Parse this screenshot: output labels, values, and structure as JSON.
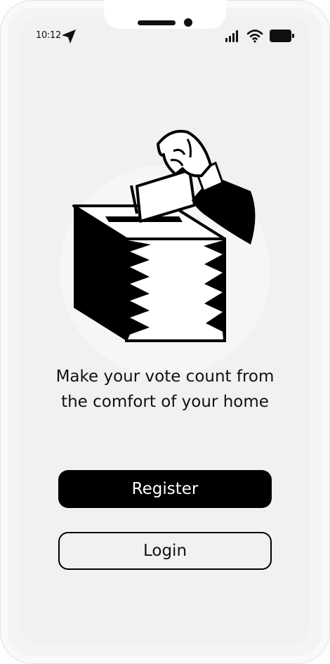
{
  "status_bar": {
    "time": "10:12",
    "icons": [
      "location-arrow-icon",
      "signal-icon",
      "wifi-icon",
      "battery-icon"
    ]
  },
  "illustration": {
    "icon": "ballot-box-illustration"
  },
  "tagline": "Make your vote count from the comfort of your home",
  "actions": {
    "register_label": "Register",
    "login_label": "Login"
  },
  "colors": {
    "primary": "#000000",
    "background": "#f1f1f1",
    "on_primary": "#ffffff"
  }
}
